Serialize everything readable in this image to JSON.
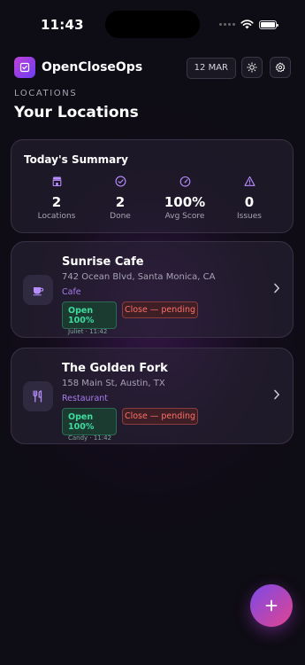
{
  "status_bar": {
    "time": "11:43"
  },
  "header": {
    "app_name": "OpenCloseOps",
    "date": "12 MAR",
    "logo_icon": "checkbox-icon",
    "theme_icon": "sun-icon",
    "settings_icon": "gear-icon"
  },
  "section_label": "LOCATIONS",
  "page_title": "Your Locations",
  "summary": {
    "title": "Today's Summary",
    "stats": [
      {
        "icon": "store-icon",
        "value": "2",
        "label": "Locations"
      },
      {
        "icon": "check-circle-icon",
        "value": "2",
        "label": "Done"
      },
      {
        "icon": "gauge-icon",
        "value": "100%",
        "label": "Avg Score"
      },
      {
        "icon": "warning-icon",
        "value": "0",
        "label": "Issues"
      }
    ]
  },
  "locations": [
    {
      "name": "Sunrise Cafe",
      "address": "742 Ocean Blvd, Santa Monica, CA",
      "category": "Cafe",
      "icon": "coffee-cup-icon",
      "open_status": "Open 100%",
      "open_meta": "Juliet · 11:42",
      "close_status": "Close — pending"
    },
    {
      "name": "The Golden Fork",
      "address": "158 Main St, Austin, TX",
      "category": "Restaurant",
      "icon": "fork-knife-icon",
      "open_status": "Open 100%",
      "open_meta": "Candy · 11:42",
      "close_status": "Close — pending"
    }
  ],
  "fab": {
    "icon": "plus-icon"
  },
  "colors": {
    "background": "#0e0c14",
    "accent_purple": "#a67bef",
    "open_green": "#3fdca0",
    "close_red": "#ff6f6a",
    "fab_gradient_start": "#7a4ae8",
    "fab_gradient_end": "#e2448f"
  }
}
